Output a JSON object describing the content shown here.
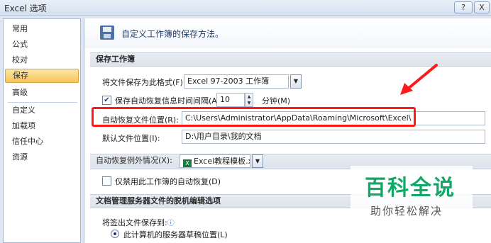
{
  "window": {
    "title": "Excel 选项",
    "help_btn": "?",
    "close_btn": "X"
  },
  "nav": {
    "items": [
      "常用",
      "公式",
      "校对",
      "保存",
      "高级",
      "自定义",
      "加载项",
      "信任中心",
      "资源"
    ],
    "active": "保存"
  },
  "header": {
    "text": "自定义工作簿的保存方法。",
    "icon": "save-icon"
  },
  "save_section": {
    "title": "保存工作簿",
    "format_label": "将文件保存为此格式(F):",
    "format_value": "Excel 97-2003 工作簿",
    "autosave_label": "保存自动恢复信息时间间隔(A)",
    "autosave_checked": true,
    "autosave_minutes": "10",
    "minutes_unit": "分钟(M)",
    "autorecover_location_label": "自动恢复文件位置(R):",
    "autorecover_location_value": "C:\\Users\\Administrator\\AppData\\Roaming\\Microsoft\\Excel\\",
    "default_location_label": "默认文件位置(I):",
    "default_location_value": "D:\\用户目录\\我的文档"
  },
  "exceptions_section": {
    "label": "自动恢复例外情况(X):",
    "workbook_value": "Excel教程模板.x...",
    "disable_label": "仅禁用此工作簿的自动恢复(D)",
    "disable_checked": false
  },
  "offline_section": {
    "title": "文档管理服务器文件的脱机编辑选项",
    "checkout_label": "将签出文件保存到:",
    "option_label": "此计算机的服务器草稿位置(L)"
  },
  "watermark": {
    "title": "百科全说",
    "subtitle": "助你轻松解决"
  },
  "colors": {
    "annotation": "#ff1a1a",
    "watermark": "#12a866",
    "nav_active": "#f7c55a"
  }
}
